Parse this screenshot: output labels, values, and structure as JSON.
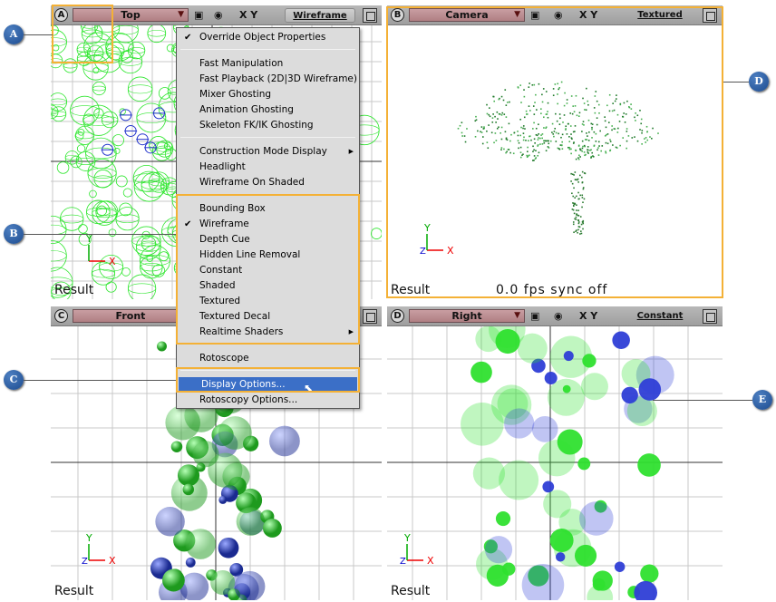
{
  "viewports": [
    {
      "letter": "A",
      "camera": "Top",
      "mode": "Wireframe",
      "axes": "X Y",
      "result": "Result"
    },
    {
      "letter": "B",
      "camera": "Camera",
      "mode": "Textured",
      "axes": "X Y",
      "result": "Result",
      "fps": "0.0  fps  sync  off"
    },
    {
      "letter": "C",
      "camera": "Front",
      "axes": "X Y",
      "result": "Result"
    },
    {
      "letter": "D",
      "camera": "Right",
      "mode": "Constant",
      "axes": "X Y",
      "result": "Result"
    }
  ],
  "menu": {
    "items": [
      {
        "label": "Override Object Properties",
        "checked": true
      },
      {
        "label": "Fast Manipulation"
      },
      {
        "label": "Fast Playback (2D|3D Wireframe)"
      },
      {
        "label": "Mixer Ghosting"
      },
      {
        "label": "Animation Ghosting"
      },
      {
        "label": "Skeleton FK/IK Ghosting"
      },
      {
        "label": "Construction Mode Display",
        "submenu": true
      },
      {
        "label": "Headlight"
      },
      {
        "label": "Wireframe On Shaded"
      },
      {
        "label": "Bounding Box"
      },
      {
        "label": "Wireframe",
        "checked": true
      },
      {
        "label": "Depth Cue"
      },
      {
        "label": "Hidden Line Removal"
      },
      {
        "label": "Constant"
      },
      {
        "label": "Shaded"
      },
      {
        "label": "Textured"
      },
      {
        "label": "Textured Decal"
      },
      {
        "label": "Realtime Shaders",
        "submenu": true
      },
      {
        "label": "Rotoscope"
      },
      {
        "label": "Display Options...",
        "active": true
      },
      {
        "label": "Rotoscopy Options..."
      }
    ]
  },
  "callouts": [
    "A",
    "B",
    "C",
    "D",
    "E"
  ],
  "axis_labels": {
    "x": "X",
    "y": "Y",
    "z": "Z"
  },
  "colors": {
    "highlight": "#f4b136",
    "camera_field": "#c99ea2",
    "menu_active": "#3b6fc7",
    "callout": "#1c4b8f"
  }
}
